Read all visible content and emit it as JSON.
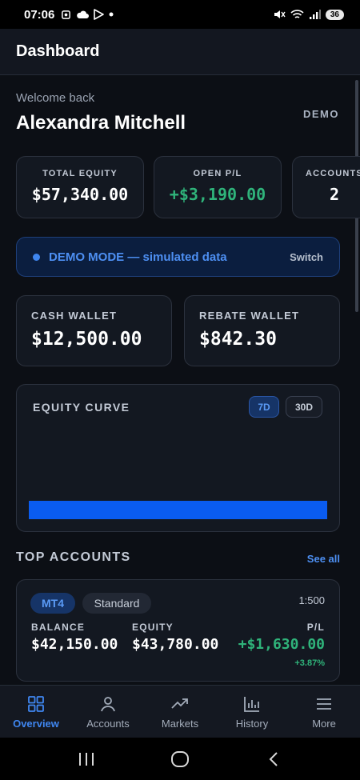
{
  "status_bar": {
    "time": "07:06",
    "battery": "36"
  },
  "app_bar": {
    "title": "Dashboard"
  },
  "header": {
    "welcome": "Welcome back",
    "user_name": "Alexandra Mitchell",
    "mode_label": "DEMO"
  },
  "stats": [
    {
      "label": "TOTAL EQUITY",
      "value": "$57,340.00"
    },
    {
      "label": "OPEN P/L",
      "value": "+$3,190.00"
    },
    {
      "label": "ACCOUNTS",
      "value": "2"
    }
  ],
  "demo_banner": {
    "text": "DEMO MODE — simulated data",
    "action": "Switch"
  },
  "wallets": [
    {
      "label": "CASH WALLET",
      "value": "$12,500.00"
    },
    {
      "label": "REBATE WALLET",
      "value": "$842.30"
    }
  ],
  "equity_curve": {
    "title": "EQUITY CURVE",
    "ranges": [
      "7D",
      "30D"
    ],
    "selected_range": "7D"
  },
  "top_accounts": {
    "title": "TOP ACCOUNTS",
    "see_all": "See all",
    "accounts": [
      {
        "platform": "MT4",
        "type": "Standard",
        "leverage": "1:500",
        "balance_label": "BALANCE",
        "balance": "$42,150.00",
        "equity_label": "EQUITY",
        "equity": "$43,780.00",
        "pl_label": "P/L",
        "pl": "+$1,630.00",
        "pl_pct": "+3.87%"
      }
    ]
  },
  "bottom_nav": [
    {
      "label": "Overview",
      "icon": "grid-icon",
      "active": true
    },
    {
      "label": "Accounts",
      "icon": "user-icon",
      "active": false
    },
    {
      "label": "Markets",
      "icon": "trending-up-icon",
      "active": false
    },
    {
      "label": "History",
      "icon": "bar-chart-icon",
      "active": false
    },
    {
      "label": "More",
      "icon": "menu-icon",
      "active": false
    }
  ],
  "colors": {
    "accent": "#3f86f0",
    "positive": "#2fb37a",
    "background": "#0c0f15",
    "card": "#131821"
  }
}
